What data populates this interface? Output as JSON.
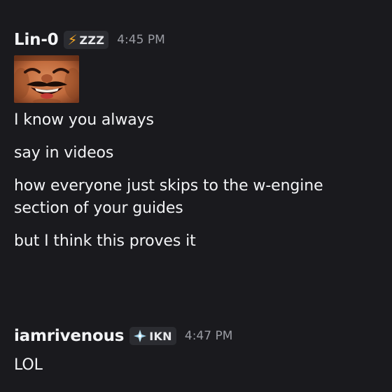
{
  "messages": [
    {
      "username": "Lin-0",
      "tag": {
        "icon": "lightning-bolt-icon",
        "label": "ZZZ"
      },
      "timestamp": "4:45 PM",
      "sticker": "laughing-face-sticker",
      "lines": [
        "I know you always",
        "say in videos",
        "how everyone just skips to the w-engine",
        "section of your guides",
        "but I think this proves it"
      ]
    },
    {
      "username": "iamrivenous",
      "tag": {
        "icon": "diamond-icon",
        "label": "IKN"
      },
      "timestamp": "4:47 PM",
      "lines": [
        "LOL"
      ]
    }
  ],
  "colors": {
    "background": "#1a1a1e",
    "text": "#f2f3f5",
    "timestamp": "#9a9ca3",
    "tag_bg": "#2b2c31",
    "bolt": "#f5a623"
  }
}
